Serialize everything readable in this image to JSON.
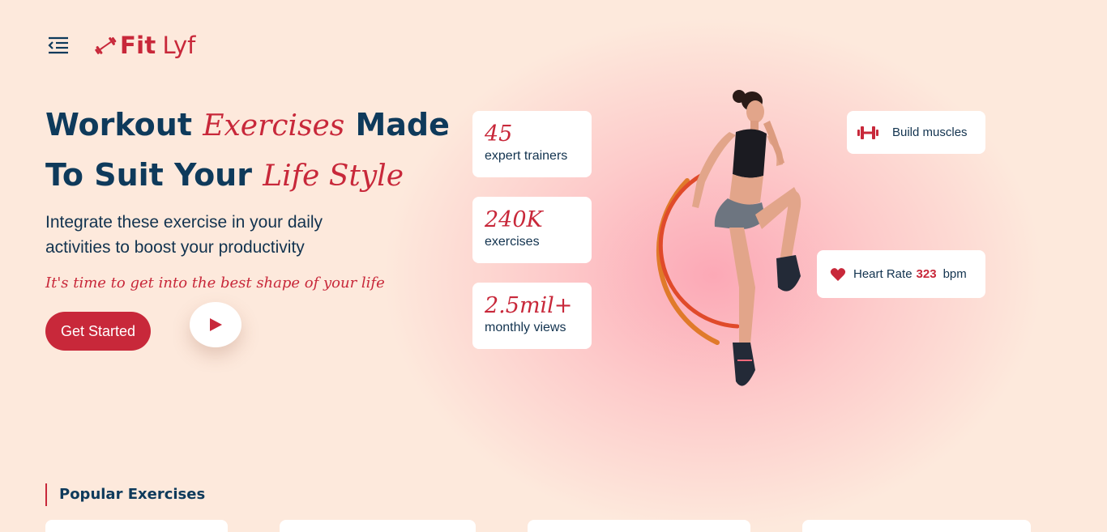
{
  "brand": {
    "name_bold": "Fit",
    "name_light": "Lyf",
    "color": "#c8283a"
  },
  "nav": {
    "menu_icon": "menu-collapse-icon"
  },
  "hero": {
    "title_1": "Workout ",
    "title_accent_1": "Exercises",
    "title_2": " Made To Suit Your ",
    "title_accent_2": "Life Style",
    "subtitle": "Integrate these exercise in your daily activities to boost your productivity",
    "tagline": "It's time to get into the best shape of your life",
    "cta_label": "Get Started",
    "play_icon": "play-icon"
  },
  "stats": [
    {
      "value": "45",
      "label": "expert trainers"
    },
    {
      "value": "240K",
      "label": "exercises"
    },
    {
      "value": "2.5mil+",
      "label": "monthly views"
    }
  ],
  "badges": {
    "build": {
      "icon": "dumbbell-icon",
      "label": "Build muscles"
    },
    "heart": {
      "icon": "heart-icon",
      "label": "Heart Rate",
      "value": "323",
      "unit": "bpm"
    }
  },
  "popular": {
    "title": "Popular Exercises"
  },
  "colors": {
    "accent": "#c8283a",
    "navy": "#0e3a5b",
    "background": "#fde9dc"
  }
}
